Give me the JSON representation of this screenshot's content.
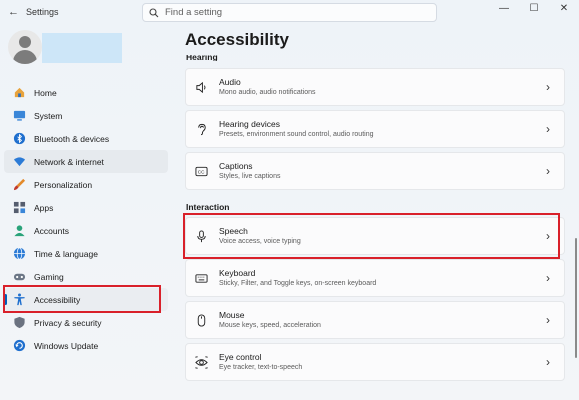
{
  "window": {
    "back_glyph": "←",
    "title": "Settings",
    "controls": [
      "—",
      "☐",
      "✕"
    ]
  },
  "search": {
    "placeholder": "Find a setting"
  },
  "sidebar": {
    "items": [
      {
        "label": "Home",
        "icon": "home-icon"
      },
      {
        "label": "System",
        "icon": "system-icon"
      },
      {
        "label": "Bluetooth & devices",
        "icon": "bluetooth-icon"
      },
      {
        "label": "Network & internet",
        "icon": "network-icon"
      },
      {
        "label": "Personalization",
        "icon": "brush-icon"
      },
      {
        "label": "Apps",
        "icon": "apps-icon"
      },
      {
        "label": "Accounts",
        "icon": "accounts-icon"
      },
      {
        "label": "Time & language",
        "icon": "globe-icon"
      },
      {
        "label": "Gaming",
        "icon": "gaming-icon"
      },
      {
        "label": "Accessibility",
        "icon": "accessibility-icon"
      },
      {
        "label": "Privacy & security",
        "icon": "shield-icon"
      },
      {
        "label": "Windows Update",
        "icon": "update-icon"
      }
    ],
    "selected_index": 9
  },
  "main": {
    "title": "Accessibility",
    "hearing_section": "Hearing",
    "hearing": [
      {
        "title": "Audio",
        "subtitle": "Mono audio, audio notifications",
        "icon": "speaker-icon"
      },
      {
        "title": "Hearing devices",
        "subtitle": "Presets, environment sound control, audio routing",
        "icon": "ear-icon"
      },
      {
        "title": "Captions",
        "subtitle": "Styles, live captions",
        "icon": "captions-icon"
      }
    ],
    "interaction_section": "Interaction",
    "interaction": [
      {
        "title": "Speech",
        "subtitle": "Voice access, voice typing",
        "icon": "microphone-icon"
      },
      {
        "title": "Keyboard",
        "subtitle": "Sticky, Filter, and Toggle keys, on-screen keyboard",
        "icon": "keyboard-icon"
      },
      {
        "title": "Mouse",
        "subtitle": "Mouse keys, speed, acceleration",
        "icon": "mouse-icon"
      },
      {
        "title": "Eye control",
        "subtitle": "Eye tracker, text-to-speech",
        "icon": "eye-icon"
      }
    ],
    "chevron": "›"
  },
  "colors": {
    "accent": "#005fb8",
    "highlight": "#d9202a"
  }
}
